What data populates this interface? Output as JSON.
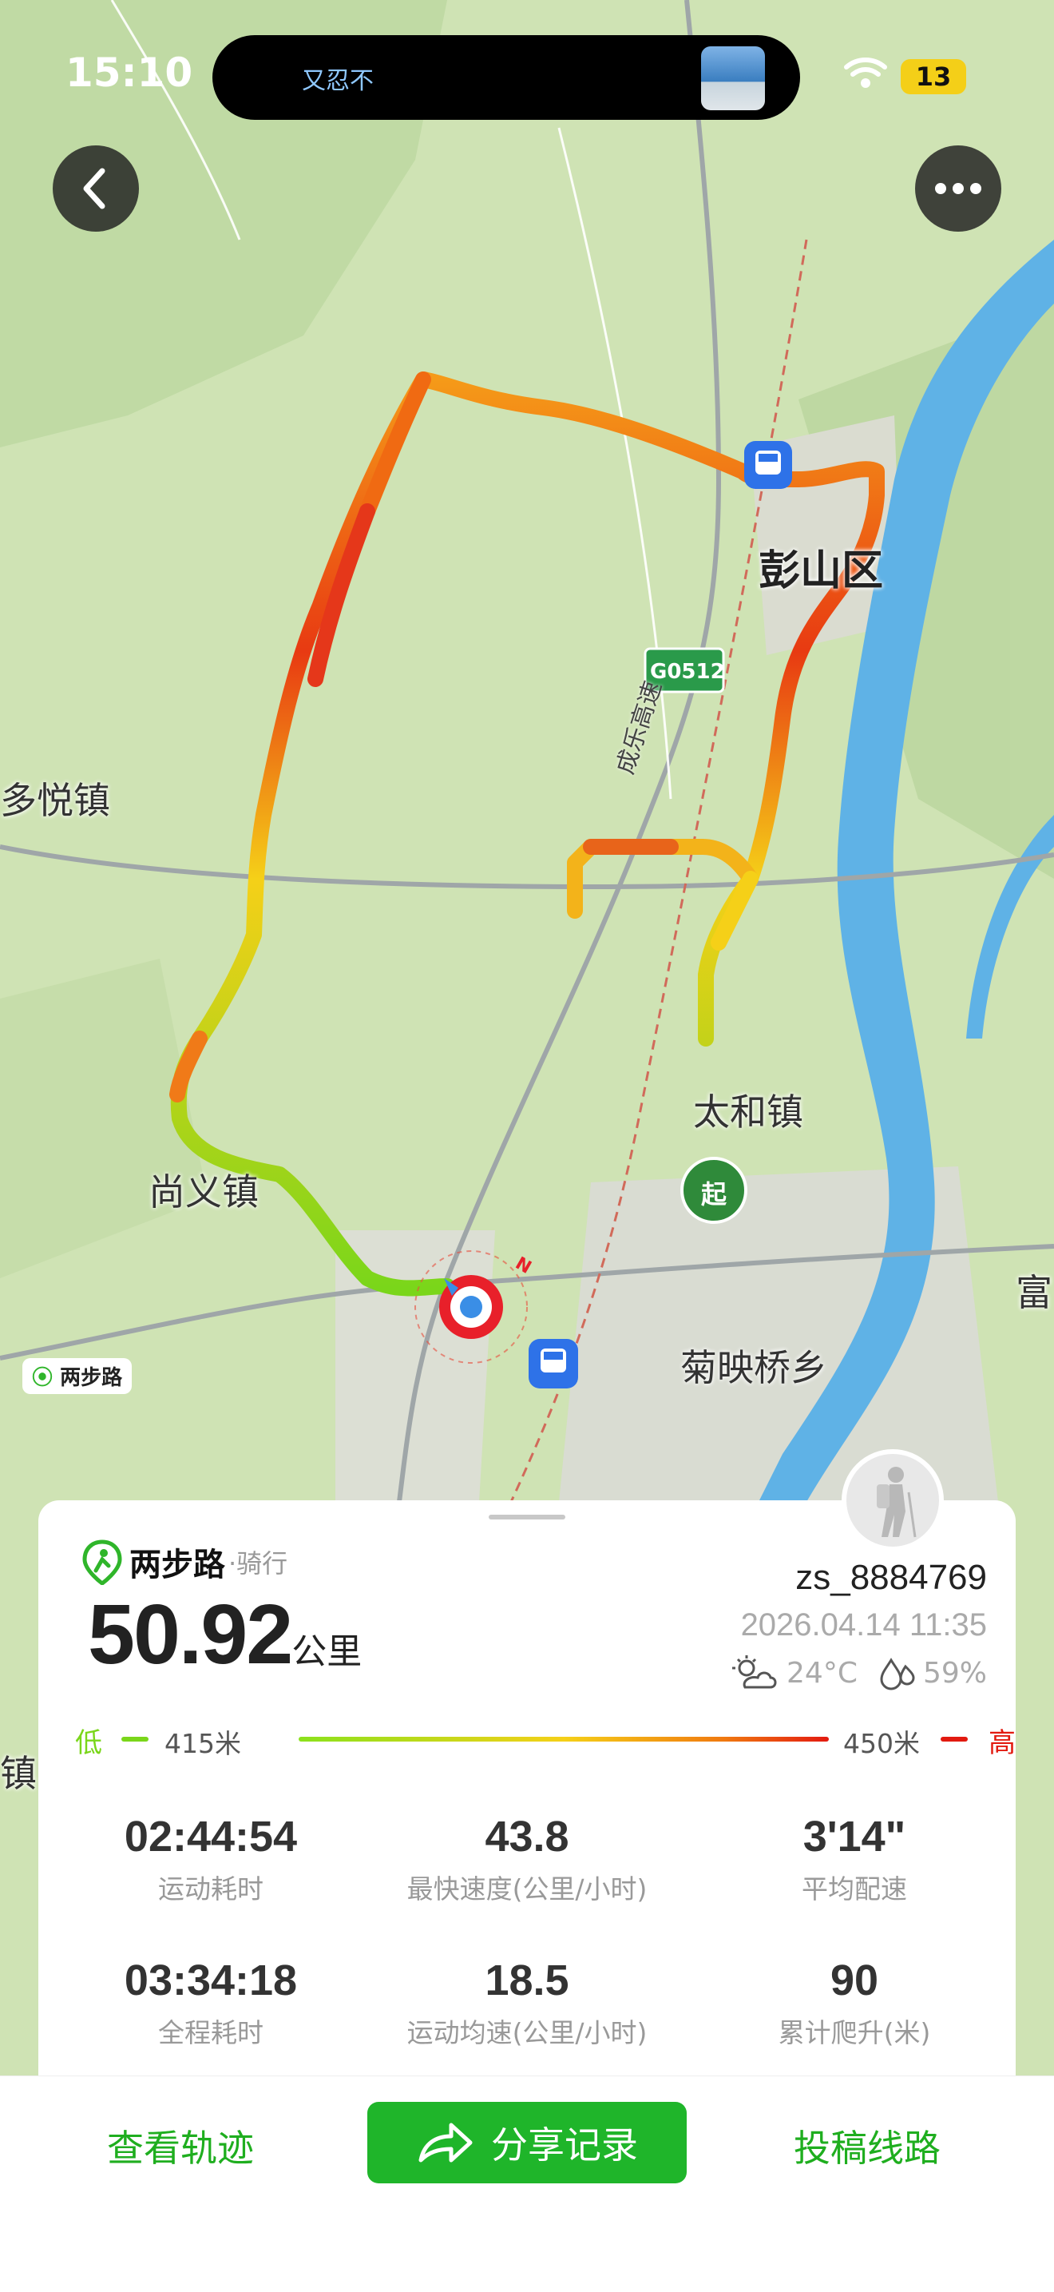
{
  "status_bar": {
    "time": "15:10",
    "island_text": "又忍不",
    "battery": "13"
  },
  "map": {
    "labels": {
      "pengshan": "彭山区",
      "duoyue": "多悦镇",
      "taihe": "太和镇",
      "shangyi": "尚义镇",
      "juying": "菊映桥乡",
      "fu": "富",
      "zhen_edge": "镇",
      "highway_badge": "G0512",
      "highway_name": "成乐高速",
      "start": "起",
      "north": "N"
    },
    "watermark": "两步路"
  },
  "card": {
    "brand": "两步路",
    "activity": "·骑行",
    "distance": "50.92",
    "distance_unit": "公里",
    "username": "zs_8884769",
    "datetime": "2026.04.14 11:35",
    "temperature": "24°C",
    "humidity": "59%",
    "elevation": {
      "low_label": "低",
      "low_value": "415米",
      "high_value": "450米",
      "high_label": "高"
    },
    "stats": [
      {
        "value": "02:44:54",
        "label": "运动耗时"
      },
      {
        "value": "43.8",
        "label": "最快速度(公里/小时)"
      },
      {
        "value": "3'14\"",
        "label": "平均配速"
      },
      {
        "value": "03:34:18",
        "label": "全程耗时"
      },
      {
        "value": "18.5",
        "label": "运动均速(公里/小时)"
      },
      {
        "value": "90",
        "label": "累计爬升(米)"
      }
    ]
  },
  "bottom": {
    "view_track": "查看轨迹",
    "share": "分享记录",
    "submit_route": "投稿线路"
  },
  "colors": {
    "accent": "#1fb52a",
    "low": "#7ad61a",
    "high": "#e21a10"
  }
}
